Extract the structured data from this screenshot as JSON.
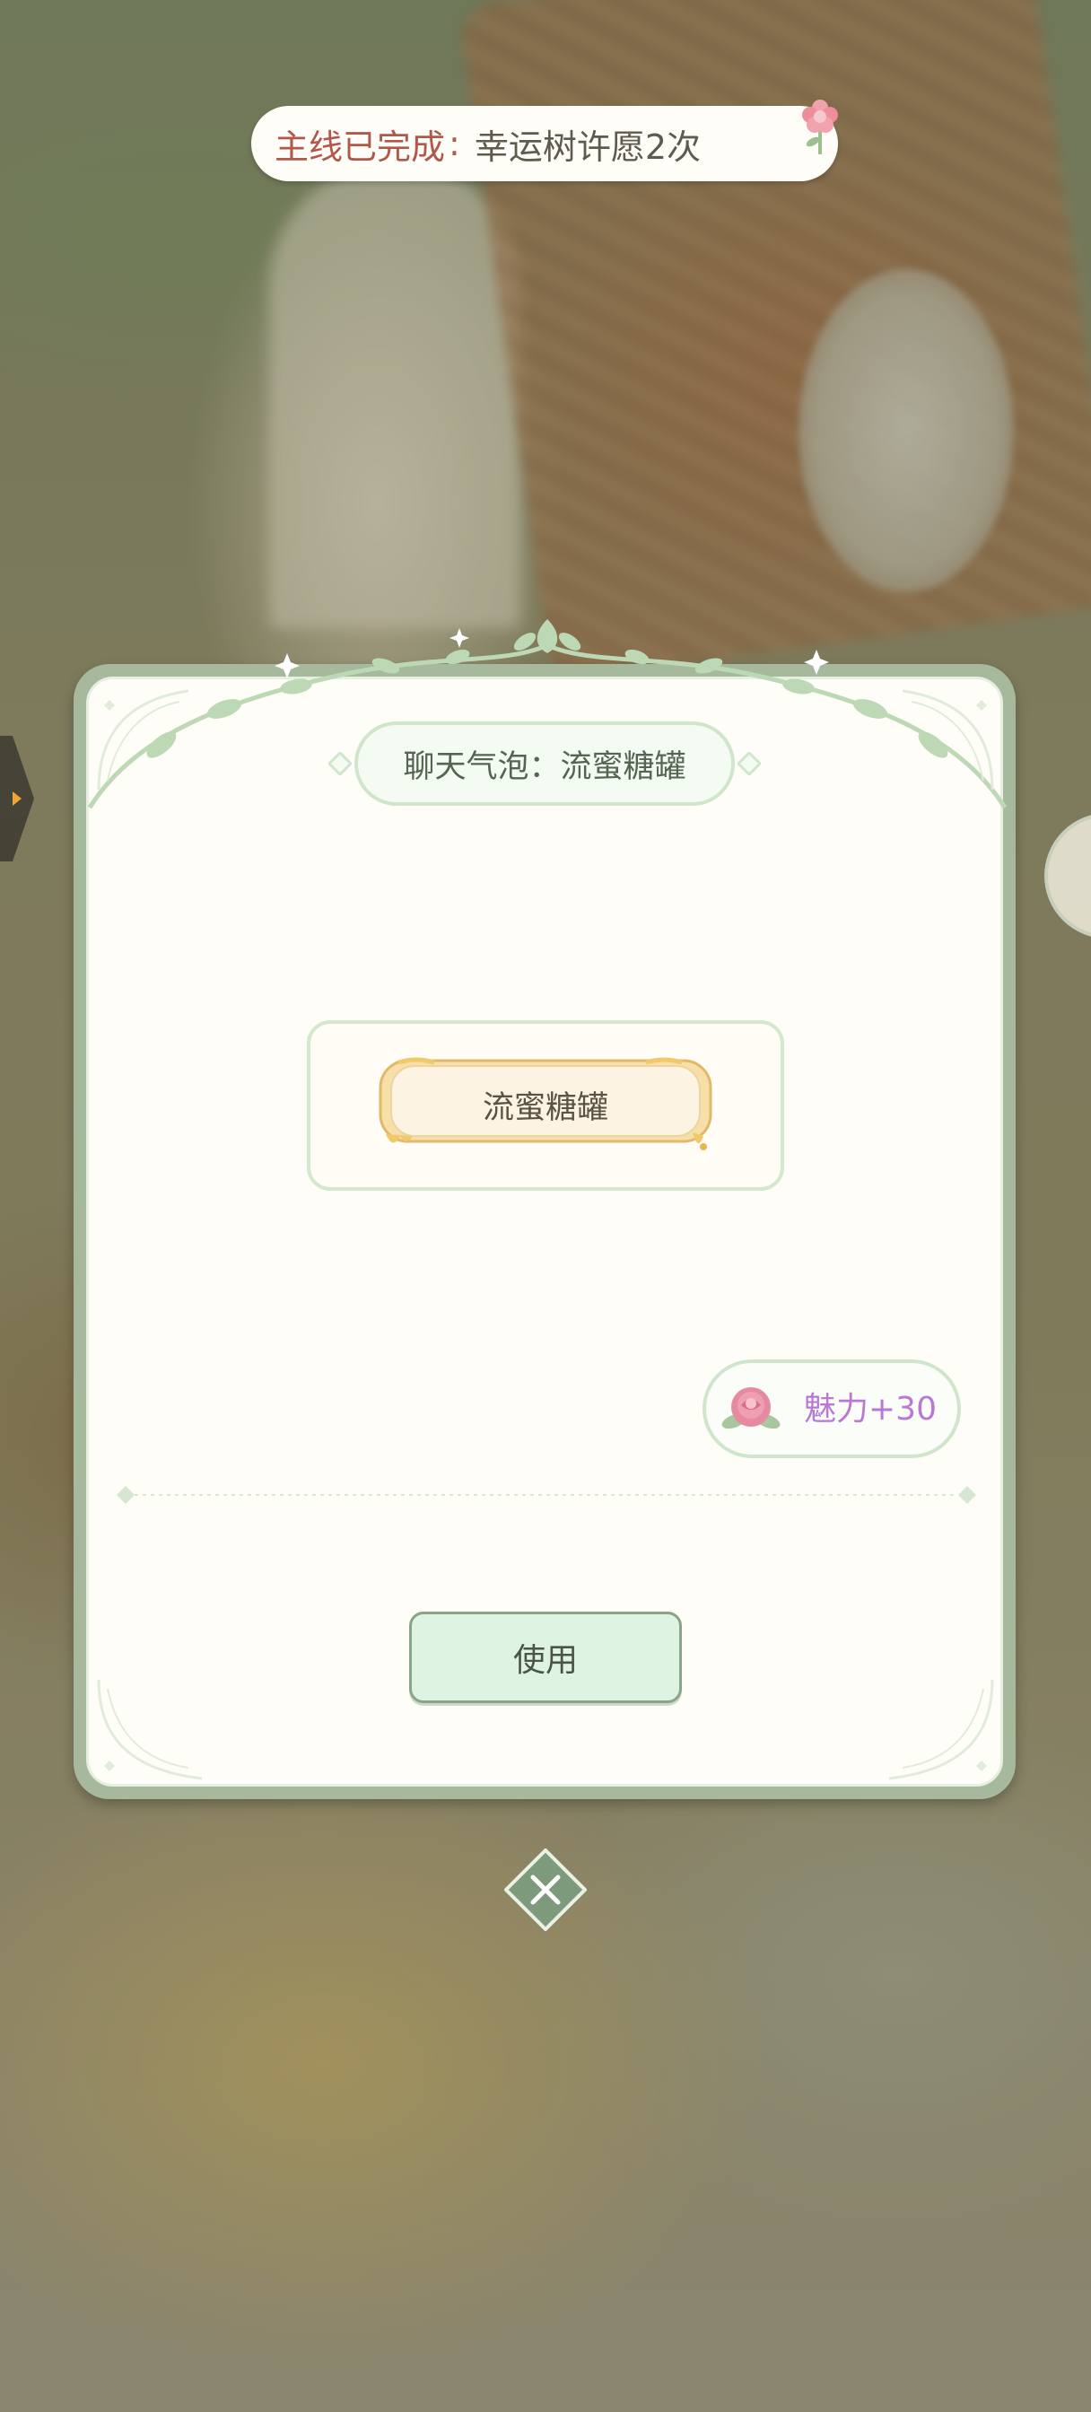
{
  "quest_banner": {
    "prefix": "主线已完成",
    "separator": ":",
    "text": "幸运树许愿2次",
    "icon": "flower-icon"
  },
  "dialog": {
    "title": "聊天气泡：流蜜糖罐",
    "preview": {
      "bubble_label": "流蜜糖罐"
    },
    "reward": {
      "icon": "rose-icon",
      "label": "魅力+30"
    },
    "use_button_label": "使用",
    "close_icon": "close-icon"
  },
  "side_tab_icon": "arrow-right-icon",
  "colors": {
    "quest_prefix": "#b0584a",
    "reward_text": "#b977d6",
    "button_fill": "#def3e1",
    "panel_border": "#a6b99d"
  }
}
